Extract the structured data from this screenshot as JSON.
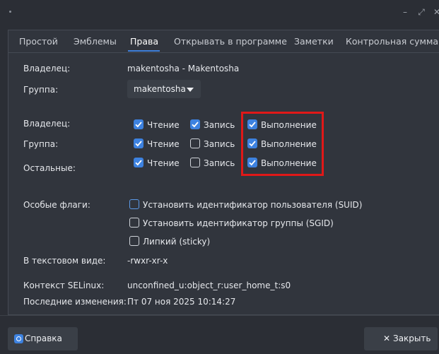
{
  "window": {
    "minimize_glyph": "–",
    "maximize_glyph": "⤢",
    "close_glyph": "✕"
  },
  "tabs": [
    {
      "label": "Простой"
    },
    {
      "label": "Эмблемы"
    },
    {
      "label": "Права"
    },
    {
      "label": "Открывать в программе"
    },
    {
      "label": "Заметки"
    },
    {
      "label": "Контрольная сумма"
    }
  ],
  "active_tab": "Права",
  "owner": {
    "label": "Владелец:",
    "value": "makentosha - Makentosha"
  },
  "group": {
    "label": "Группа:",
    "value": "makentosha"
  },
  "permissions": [
    {
      "label": "Владелец:",
      "read": {
        "label": "Чтение",
        "checked": true
      },
      "write": {
        "label": "Запись",
        "checked": true
      },
      "exec": {
        "label": "Выполнение",
        "checked": true
      }
    },
    {
      "label": "Группа:",
      "read": {
        "label": "Чтение",
        "checked": true
      },
      "write": {
        "label": "Запись",
        "checked": false
      },
      "exec": {
        "label": "Выполнение",
        "checked": true
      }
    },
    {
      "label": "Остальные:",
      "read": {
        "label": "Чтение",
        "checked": true
      },
      "write": {
        "label": "Запись",
        "checked": false
      },
      "exec": {
        "label": "Выполнение",
        "checked": true
      }
    }
  ],
  "special_flags": {
    "label": "Особые флаги:",
    "items": [
      {
        "label": "Установить идентификатор пользователя (SUID)",
        "checked": false
      },
      {
        "label": "Установить идентификатор группы (SGID)",
        "checked": false
      },
      {
        "label": "Липкий (sticky)",
        "checked": false
      }
    ]
  },
  "text_view": {
    "label": "В текстовом виде:",
    "value": "-rwxr-xr-x"
  },
  "selinux": {
    "label": "Контекст SELinux:",
    "value": "unconfined_u:object_r:user_home_t:s0"
  },
  "last_modified": {
    "label": "Последние изменения:",
    "value": "Пт 07 ноя 2025 10:14:27"
  },
  "buttons": {
    "help": "Справка",
    "close": "Закрыть"
  },
  "colors": {
    "accent": "#3d82e0",
    "highlight": "#e01818",
    "background": "#2b2e35"
  }
}
